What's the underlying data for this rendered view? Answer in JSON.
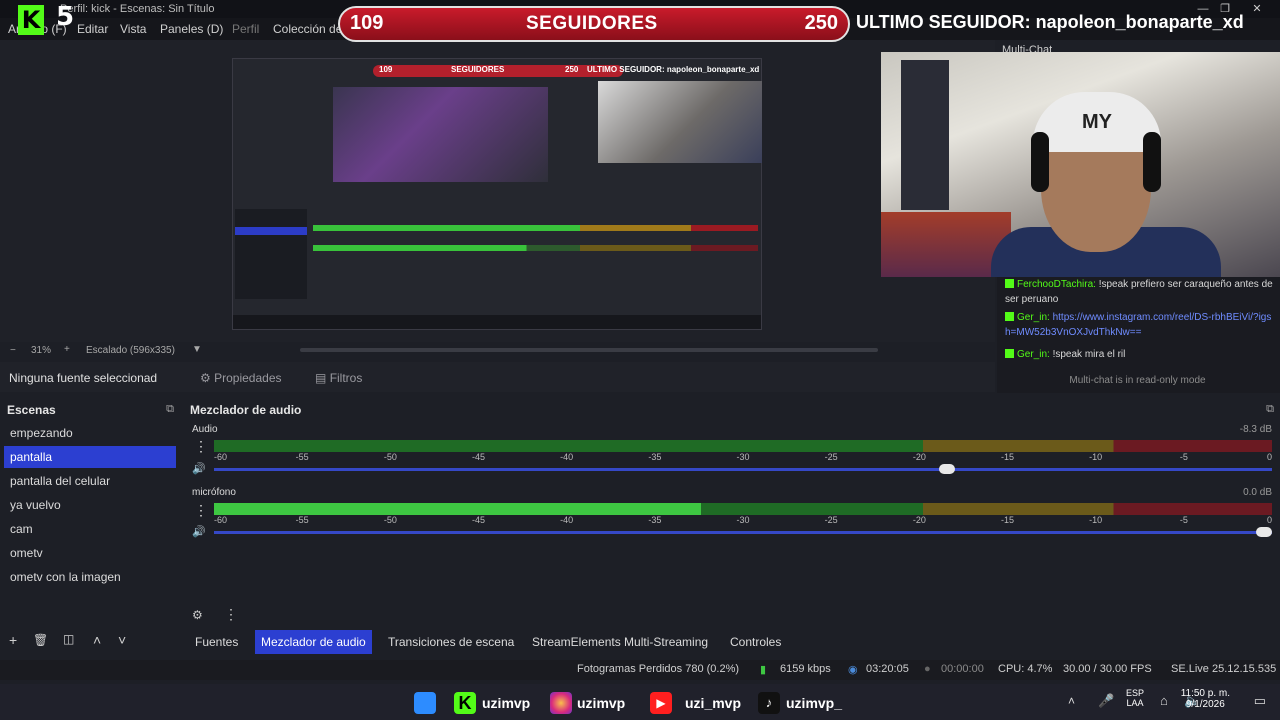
{
  "titlebar": {
    "title": "Perfil: kick - Escenas: Sin Título"
  },
  "menu": {
    "items": [
      "Archivo (F)",
      "Editar",
      "Vista",
      "Paneles (D)",
      "Perfil",
      "Colección de"
    ]
  },
  "overlay": {
    "logo_k": "K",
    "logo_num": "5",
    "followers_current": "109",
    "followers_label": "SEGUIDORES",
    "followers_goal": "250",
    "last_follower": "ULTIMO SEGUIDOR: napoleon_bonaparte_xd"
  },
  "webcam": {
    "cap_text": "MY"
  },
  "multichat": {
    "title": "Multi-Chat",
    "messages": [
      {
        "user": "FerchooDTachira:",
        "text": "!speak prefiero ser caraqueño antes de ser peruano"
      },
      {
        "user": "Ger_in:",
        "text": "https://www.instagram.com/reel/DS-rbhBEiVi/?igsh=MW52b3VnOXJvdThkNw=="
      },
      {
        "user": "Ger_in:",
        "text": "!speak mira el ril"
      }
    ],
    "readonly_note": "Multi-chat is in read-only mode"
  },
  "zoom": {
    "minus": "−",
    "value": "31%",
    "plus": "+",
    "scale": "Escalado (596x335)"
  },
  "sourcebar": {
    "no_source": "Ninguna fuente seleccionad",
    "properties": "Propiedades",
    "filters": "Filtros"
  },
  "scenes": {
    "title": "Escenas",
    "items": [
      "empezando",
      "pantalla",
      "pantalla del celular",
      "ya vuelvo",
      "cam",
      "ometv",
      "ometv con la imagen"
    ],
    "selected_index": 1
  },
  "mixer": {
    "title": "Mezclador de audio",
    "ticks": [
      "-60",
      "-55",
      "-50",
      "-45",
      "-40",
      "-35",
      "-30",
      "-25",
      "-20",
      "-15",
      "-10",
      "-5",
      "0"
    ],
    "channels": [
      {
        "name": "Audio",
        "db": "-8.3 dB",
        "level_fraction": 0.0,
        "volume_fraction": 0.7
      },
      {
        "name": "micrófono",
        "db": "0.0 dB",
        "level_fraction": 0.46,
        "volume_fraction": 1.0
      }
    ]
  },
  "tabs": [
    "Fuentes",
    "Mezclador de audio",
    "Transiciones de escena",
    "StreamElements Multi-Streaming",
    "Controles"
  ],
  "active_tab": 1,
  "status": {
    "dropped": "Fotogramas Perdidos 780 (0.2%)",
    "bitrate": "6159 kbps",
    "live_time": "03:20:05",
    "rec_time": "00:00:00",
    "cpu": "CPU: 4.7%",
    "fps": "30.00 / 30.00 FPS",
    "version": "SE.Live 25.12.15.535"
  },
  "taskbar": {
    "labels": [
      "uzimvp",
      "uzimvp",
      "uzi_mvp",
      "uzimvp_"
    ],
    "lang": "ESP",
    "layout": "LAA",
    "time": "11:50 p. m.",
    "date": "9/1/2026"
  },
  "colors": {
    "accent": "#2c3fd1",
    "kick_green": "#53fc18",
    "banner_red": "#c91b2b"
  }
}
